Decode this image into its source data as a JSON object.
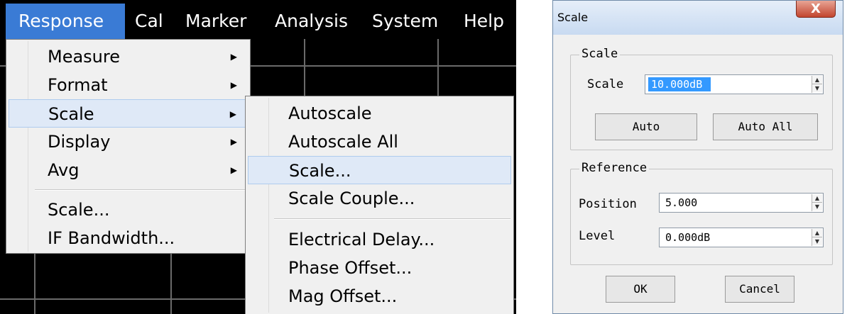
{
  "menubar": {
    "items": [
      {
        "label": "Response"
      },
      {
        "label": "Cal"
      },
      {
        "label": "Marker"
      },
      {
        "label": "Analysis"
      },
      {
        "label": "System"
      },
      {
        "label": "Help"
      }
    ]
  },
  "response_menu": {
    "items": [
      {
        "label": "Measure",
        "arrow": "▶"
      },
      {
        "label": "Format",
        "arrow": "▶"
      },
      {
        "label": "Scale",
        "arrow": "▶"
      },
      {
        "label": "Display",
        "arrow": "▶"
      },
      {
        "label": "Avg",
        "arrow": "▶"
      },
      {
        "label": "Scale..."
      },
      {
        "label": "IF Bandwidth..."
      }
    ]
  },
  "scale_submenu": {
    "items": [
      {
        "label": "Autoscale"
      },
      {
        "label": "Autoscale All"
      },
      {
        "label": "Scale..."
      },
      {
        "label": "Scale Couple..."
      },
      {
        "label": "Electrical Delay..."
      },
      {
        "label": "Phase Offset..."
      },
      {
        "label": "Mag Offset..."
      }
    ]
  },
  "dialog": {
    "title": "Scale",
    "close_glyph": "X",
    "scale_group": {
      "legend": "Scale",
      "scale_label": "Scale",
      "scale_value": "10.000dB",
      "auto_button": "Auto",
      "auto_all_button": "Auto All"
    },
    "reference_group": {
      "legend": "Reference",
      "position_label": "Position",
      "position_value": "5.000",
      "level_label": "Level",
      "level_value": "0.000dB"
    },
    "ok_button": "OK",
    "cancel_button": "Cancel"
  },
  "colors": {
    "menubar_bg": "#000000",
    "menubar_active": "#3a7bd5",
    "menu_bg": "#f0f0f0",
    "highlight": "#dfe9f7",
    "selection": "#3399ff",
    "close_button": "#c2452e"
  },
  "icons": {
    "submenu_arrow": "chevron-right-icon",
    "spin": "spin-up-down-icon",
    "close": "close-icon"
  }
}
